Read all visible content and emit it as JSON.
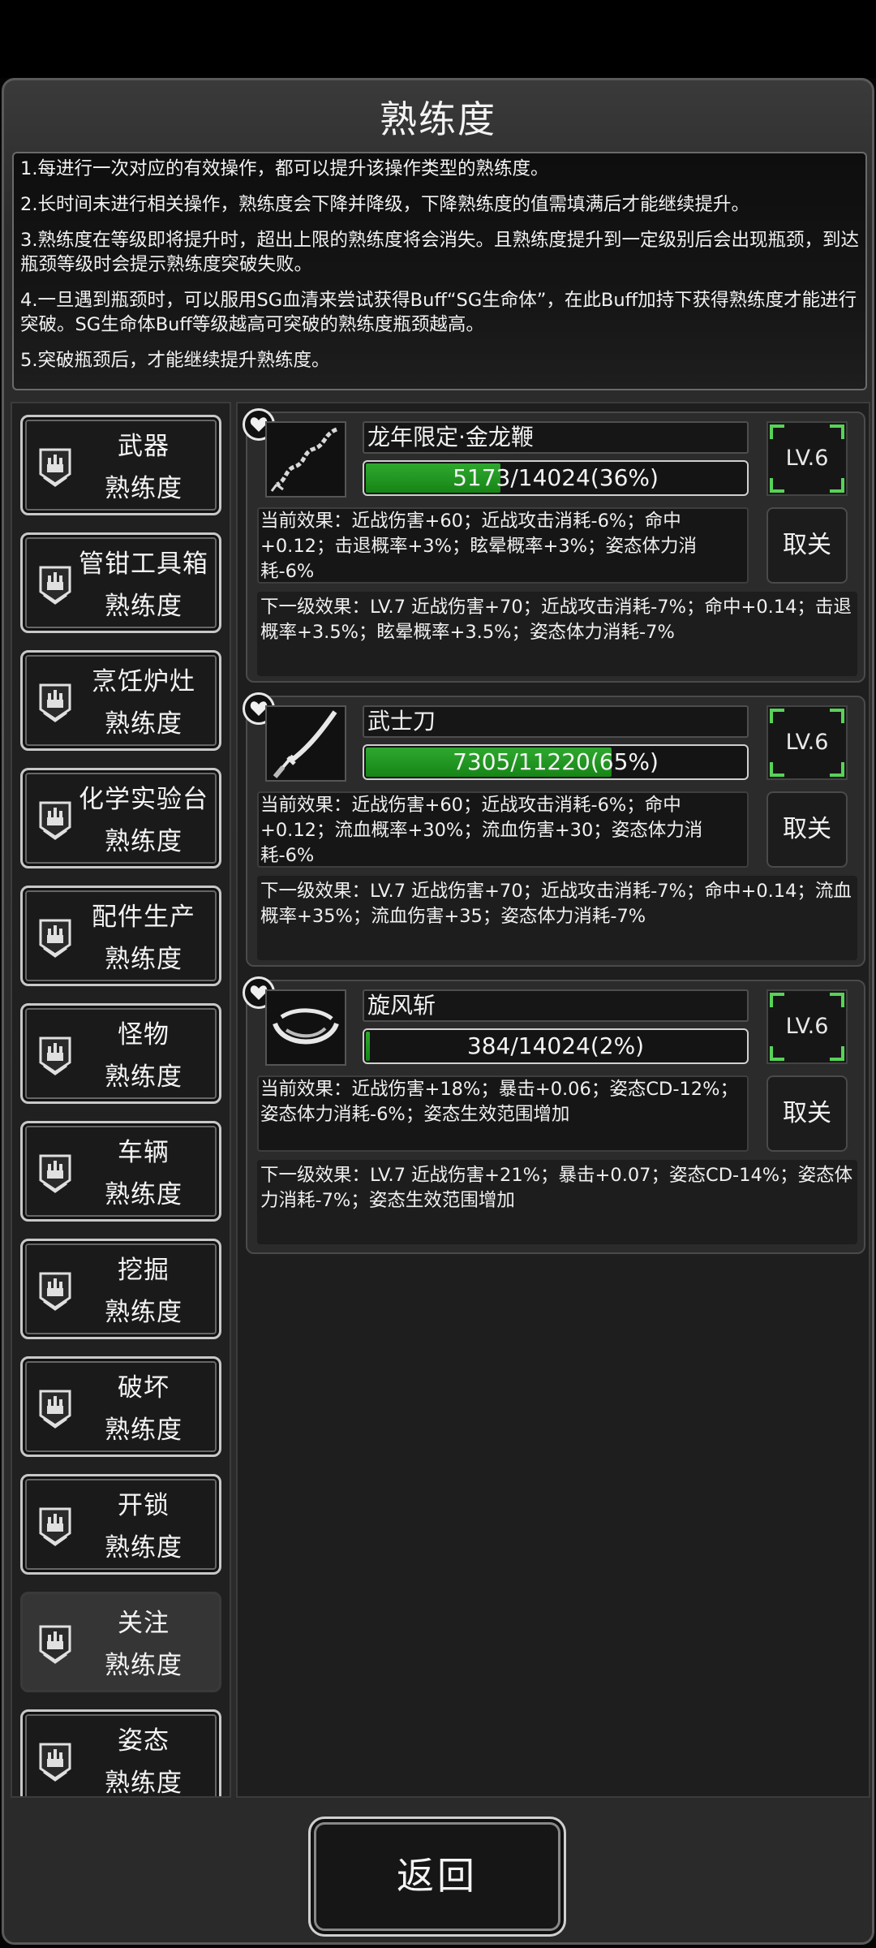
{
  "title": "熟练度",
  "rules": [
    "1.每进行一次对应的有效操作，都可以提升该操作类型的熟练度。",
    "2.长时间未进行相关操作，熟练度会下降并降级，下降熟练度的值需填满后才能继续提升。",
    "3.熟练度在等级即将提升时，超出上限的熟练度将会消失。且熟练度提升到一定级别后会出现瓶颈，到达瓶颈等级时会提示熟练度突破失败。",
    "4.一旦遇到瓶颈时，可以服用SG血清来尝试获得Buff“SG生命体”，在此Buff加持下获得熟练度才能进行突破。SG生命体Buff等级越高可突破的熟练度瓶颈越高。",
    "5.突破瓶颈后，才能继续提升熟练度。"
  ],
  "categories": [
    {
      "l1": "武器",
      "l2": "熟练度"
    },
    {
      "l1": "管钳工具箱",
      "l2": "熟练度"
    },
    {
      "l1": "烹饪炉灶",
      "l2": "熟练度"
    },
    {
      "l1": "化学实验台",
      "l2": "熟练度"
    },
    {
      "l1": "配件生产",
      "l2": "熟练度"
    },
    {
      "l1": "怪物",
      "l2": "熟练度"
    },
    {
      "l1": "车辆",
      "l2": "熟练度"
    },
    {
      "l1": "挖掘",
      "l2": "熟练度"
    },
    {
      "l1": "破坏",
      "l2": "熟练度"
    },
    {
      "l1": "开锁",
      "l2": "熟练度"
    },
    {
      "l1": "关注",
      "l2": "熟练度"
    },
    {
      "l1": "姿态",
      "l2": "熟练度"
    }
  ],
  "active_category": "关注",
  "items": [
    {
      "name": "龙年限定·金龙鞭",
      "progress_text": "5173/14024(36%)",
      "progress_fraction": 0.36,
      "level": "LV.6",
      "current_effect": "当前效果：近战伤害+60；近战攻击消耗-6%；命中+0.12；击退概率+3%；眩晕概率+3%；姿态体力消耗-6%",
      "cancel_label": "取关",
      "next_effect": "下一级效果：LV.7 近战伤害+70；近战攻击消耗-7%；命中+0.14；击退概率+3.5%；眩晕概率+3.5%；姿态体力消耗-7%",
      "icon": "whip-icon"
    },
    {
      "name": "武士刀",
      "progress_text": "7305/11220(65%)",
      "progress_fraction": 0.65,
      "level": "LV.6",
      "current_effect": "当前效果：近战伤害+60；近战攻击消耗-6%；命中+0.12；流血概率+30%；流血伤害+30；姿态体力消耗-6%",
      "cancel_label": "取关",
      "next_effect": "下一级效果：LV.7 近战伤害+70；近战攻击消耗-7%；命中+0.14；流血概率+35%；流血伤害+35；姿态体力消耗-7%",
      "icon": "katana-icon"
    },
    {
      "name": "旋风斩",
      "progress_text": "384/14024(2%)",
      "progress_fraction": 0.02,
      "level": "LV.6",
      "current_effect": "当前效果：近战伤害+18%；暴击+0.06；姿态CD-12%；姿态体力消耗-6%；姿态生效范围增加",
      "cancel_label": "取关",
      "next_effect": "下一级效果：LV.7 近战伤害+21%；暴击+0.07；姿态CD-14%；姿态体力消耗-7%；姿态生效范围增加",
      "icon": "whirlwind-icon"
    }
  ],
  "back_label": "返回",
  "colors": {
    "progress_fill": "#1f9a1f",
    "level_corner": "#57d357"
  }
}
